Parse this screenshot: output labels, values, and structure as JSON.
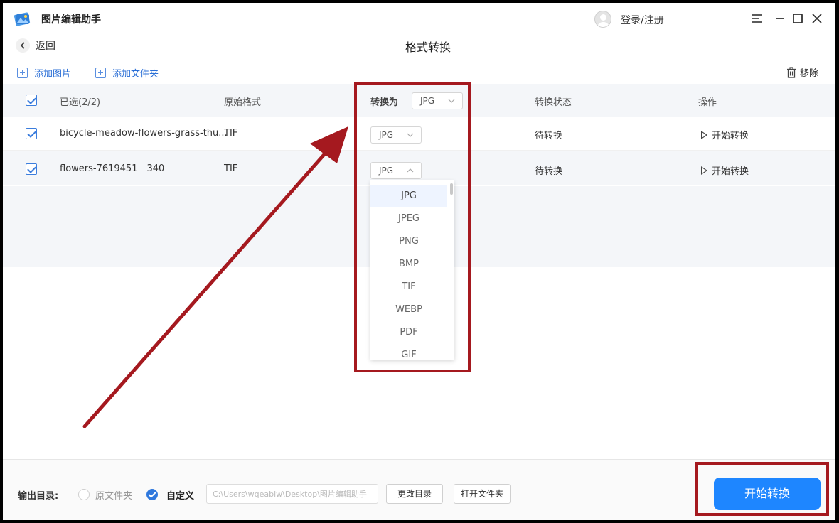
{
  "app": {
    "title": "图片编辑助手",
    "login": "登录/注册"
  },
  "nav": {
    "back": "返回",
    "page_title": "格式转换"
  },
  "toolbar": {
    "add_image": "添加图片",
    "add_folder": "添加文件夹",
    "remove": "移除"
  },
  "table": {
    "headers": {
      "selected": "已选(2/2)",
      "orig_format": "原始格式",
      "convert_to": "转换为",
      "convert_to_value": "JPG",
      "status": "转换状态",
      "actions": "操作"
    },
    "rows": [
      {
        "name": "bicycle-meadow-flowers-grass-thu...",
        "format": "TIF",
        "target": "JPG",
        "status": "待转换",
        "action": "开始转换"
      },
      {
        "name": "flowers-7619451__340",
        "format": "TIF",
        "target": "JPG",
        "status": "待转换",
        "action": "开始转换"
      }
    ]
  },
  "dropdown": {
    "options": [
      "JPG",
      "JPEG",
      "PNG",
      "BMP",
      "TIF",
      "WEBP",
      "PDF",
      "GIF"
    ],
    "selected": "JPG"
  },
  "bottom": {
    "output_label": "输出目录:",
    "option_original": "原文件夹",
    "option_custom": "自定义",
    "path_value": "C:\\Users\\wqeabiw\\Desktop\\图片编辑助手",
    "change_dir": "更改目录",
    "open_folder": "打开文件夹",
    "start_all": "开始转换"
  },
  "colors": {
    "accent": "#1e86ff",
    "annotation": "#a5191f"
  }
}
